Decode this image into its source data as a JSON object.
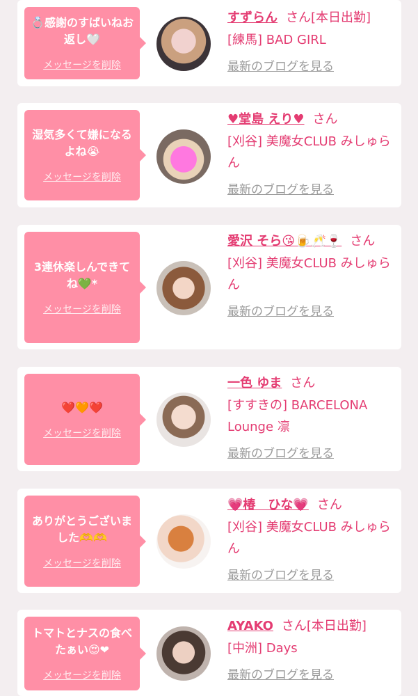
{
  "items": [
    {
      "message": "💍感謝のすばいねお返し🤍",
      "delete_label": "メッセージを削除",
      "name": "すずらん",
      "honorific": "さん",
      "badge": "[本日出勤]",
      "shop": "[練馬] BAD GIRL",
      "blog_link": "最新のブログを見る"
    },
    {
      "message": "湿気多くて嫌になるよね😭",
      "delete_label": "メッセージを削除",
      "name": "♥堂島 えり♥",
      "honorific": "さん",
      "badge": "",
      "shop": "[刈谷] 美魔女CLUB みしゅらん",
      "blog_link": "最新のブログを見る"
    },
    {
      "message": "3連休楽しんできてね💚*",
      "delete_label": "メッセージを削除",
      "name": "愛沢 そら😘🍺🥂🍷",
      "honorific": "さん",
      "badge": "",
      "shop": "[刈谷] 美魔女CLUB みしゅらん",
      "blog_link": "最新のブログを見る"
    },
    {
      "message": "❤️🧡❤️",
      "delete_label": "メッセージを削除",
      "name": "一色 ゆま",
      "honorific": "さん",
      "badge": "",
      "shop": "[すすきの] BARCELONA Lounge 凛",
      "blog_link": "最新のブログを見る"
    },
    {
      "message": "ありがとうございました🫶🫶",
      "delete_label": "メッセージを削除",
      "name": "💗椿　ひな💗",
      "honorific": "さん",
      "badge": "",
      "shop": "[刈谷] 美魔女CLUB みしゅらん",
      "blog_link": "最新のブログを見る"
    },
    {
      "message": "トマトとナスの食べたぁい😍❤",
      "delete_label": "メッセージを削除",
      "name": "AYAKO",
      "honorific": "さん",
      "badge": "[本日出勤]",
      "shop": "[中洲] Days",
      "blog_link": "最新のブログを見る"
    }
  ],
  "colors": {
    "accent": "#e43c72",
    "bubble": "#ff8fa6",
    "background": "#f3eef0",
    "muted": "#9a9a9a"
  }
}
